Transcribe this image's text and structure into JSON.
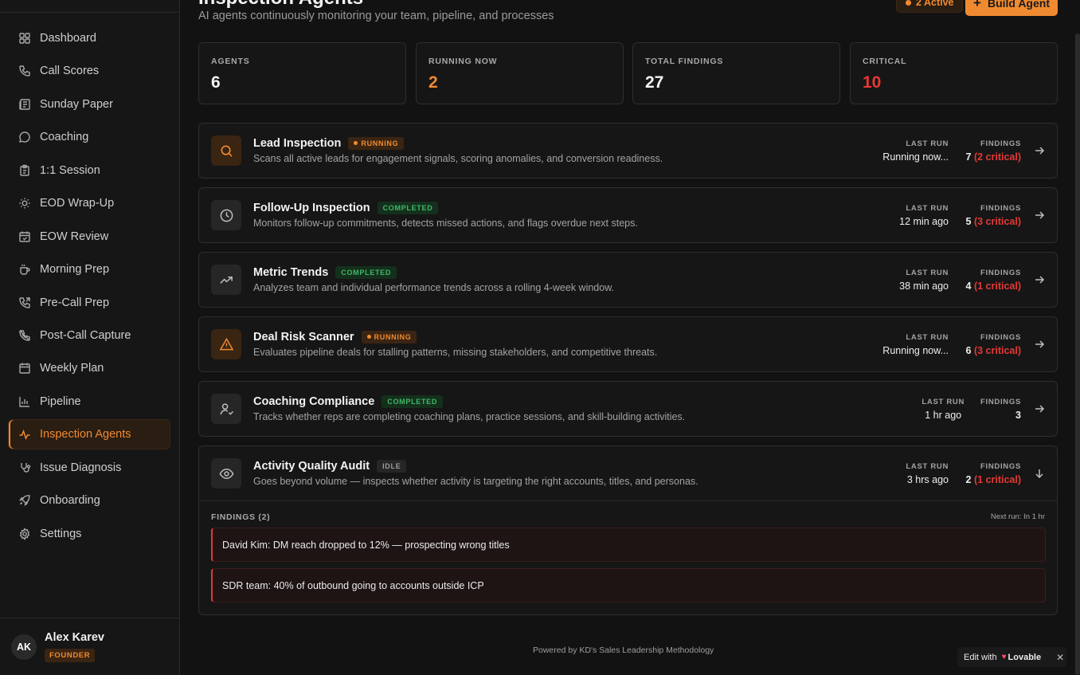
{
  "header": {
    "title": "Inspection Agents",
    "subtitle": "AI agents continuously monitoring your team, pipeline, and processes",
    "active_count": "2 Active",
    "build_button": "Build Agent"
  },
  "sidebar": {
    "items": [
      {
        "label": "Dashboard",
        "icon": "grid-icon"
      },
      {
        "label": "Call Scores",
        "icon": "phone-icon"
      },
      {
        "label": "Sunday Paper",
        "icon": "newspaper-icon"
      },
      {
        "label": "Coaching",
        "icon": "message-icon"
      },
      {
        "label": "1:1 Session",
        "icon": "clipboard-icon"
      },
      {
        "label": "EOD Wrap-Up",
        "icon": "sun-icon"
      },
      {
        "label": "EOW Review",
        "icon": "calendar-check-icon"
      },
      {
        "label": "Morning Prep",
        "icon": "coffee-icon"
      },
      {
        "label": "Pre-Call Prep",
        "icon": "phone-forward-icon"
      },
      {
        "label": "Post-Call Capture",
        "icon": "phone-off-icon"
      },
      {
        "label": "Weekly Plan",
        "icon": "calendar-icon"
      },
      {
        "label": "Pipeline",
        "icon": "bar-chart-icon"
      },
      {
        "label": "Inspection Agents",
        "icon": "activity-icon",
        "active": true
      },
      {
        "label": "Issue Diagnosis",
        "icon": "stethoscope-icon"
      },
      {
        "label": "Onboarding",
        "icon": "rocket-icon"
      },
      {
        "label": "Settings",
        "icon": "gear-icon"
      }
    ],
    "user": {
      "initials": "AK",
      "name": "Alex Karev",
      "role": "FOUNDER"
    }
  },
  "stats": [
    {
      "label": "AGENTS",
      "value": "6"
    },
    {
      "label": "RUNNING NOW",
      "value": "2"
    },
    {
      "label": "TOTAL FINDINGS",
      "value": "27"
    },
    {
      "label": "CRITICAL",
      "value": "10"
    }
  ],
  "agents": [
    {
      "name": "Lead Inspection",
      "status": "RUNNING",
      "desc": "Scans all active leads for engagement signals, scoring anomalies, and conversion readiness.",
      "last_run_label": "LAST RUN",
      "last_run": "Running now...",
      "findings_label": "FINDINGS",
      "findings": "7",
      "critical": "(2 critical)",
      "icon": "search-icon"
    },
    {
      "name": "Follow-Up Inspection",
      "status": "COMPLETED",
      "desc": "Monitors follow-up commitments, detects missed actions, and flags overdue next steps.",
      "last_run_label": "LAST RUN",
      "last_run": "12 min ago",
      "findings_label": "FINDINGS",
      "findings": "5",
      "critical": "(3 critical)",
      "icon": "clock-icon"
    },
    {
      "name": "Metric Trends",
      "status": "COMPLETED",
      "desc": "Analyzes team and individual performance trends across a rolling 4-week window.",
      "last_run_label": "LAST RUN",
      "last_run": "38 min ago",
      "findings_label": "FINDINGS",
      "findings": "4",
      "critical": "(1 critical)",
      "icon": "trending-up-icon"
    },
    {
      "name": "Deal Risk Scanner",
      "status": "RUNNING",
      "desc": "Evaluates pipeline deals for stalling patterns, missing stakeholders, and competitive threats.",
      "last_run_label": "LAST RUN",
      "last_run": "Running now...",
      "findings_label": "FINDINGS",
      "findings": "6",
      "critical": "(3 critical)",
      "icon": "warning-icon"
    },
    {
      "name": "Coaching Compliance",
      "status": "COMPLETED",
      "desc": "Tracks whether reps are completing coaching plans, practice sessions, and skill-building activities.",
      "last_run_label": "LAST RUN",
      "last_run": "1 hr ago",
      "findings_label": "FINDINGS",
      "findings": "3",
      "critical": "",
      "icon": "user-check-icon"
    },
    {
      "name": "Activity Quality Audit",
      "status": "IDLE",
      "desc": "Goes beyond volume — inspects whether activity is targeting the right accounts, titles, and personas.",
      "last_run_label": "LAST RUN",
      "last_run": "3 hrs ago",
      "findings_label": "FINDINGS",
      "findings": "2",
      "critical": "(1 critical)",
      "icon": "eye-icon"
    }
  ],
  "expanded": {
    "findings_header": "FINDINGS (2)",
    "next_run": "Next run: In 1 hr",
    "items": [
      "David Kim: DM reach dropped to 12% — prospecting wrong titles",
      "SDR team: 40% of outbound going to accounts outside ICP"
    ]
  },
  "footer": "Powered by KD's Sales Leadership Methodology",
  "lovable": {
    "prefix": "Edit with",
    "brand": "Lovable"
  },
  "colors": {
    "accent": "#f08a30",
    "critical": "#e53935",
    "success": "#3fb967"
  }
}
